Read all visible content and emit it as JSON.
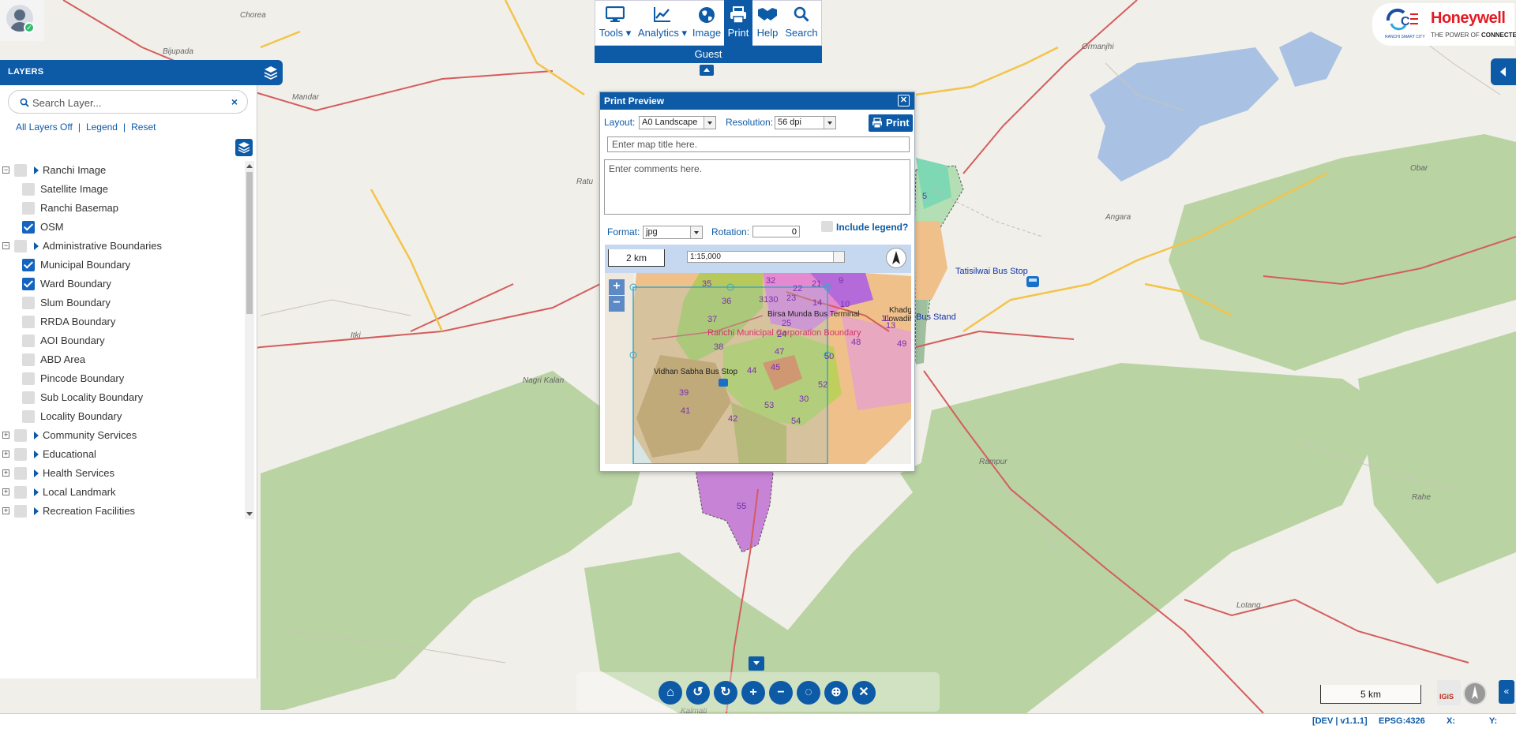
{
  "user": {
    "status": "online"
  },
  "layers_panel": {
    "title": "LAYERS",
    "search_placeholder": "Search Layer...",
    "clear_label": "×",
    "links": {
      "all_off": "All Layers Off",
      "legend": "Legend",
      "reset": "Reset"
    },
    "tree": [
      {
        "label": "Ranchi Image",
        "type": "group",
        "expand": "−",
        "checked": false
      },
      {
        "label": "Satellite Image",
        "type": "item",
        "checked": false
      },
      {
        "label": "Ranchi Basemap",
        "type": "item",
        "checked": false
      },
      {
        "label": "OSM",
        "type": "item",
        "checked": true
      },
      {
        "label": "Administrative Boundaries",
        "type": "group",
        "expand": "−",
        "checked": false
      },
      {
        "label": "Municipal Boundary",
        "type": "item",
        "checked": true
      },
      {
        "label": "Ward Boundary",
        "type": "item",
        "checked": true
      },
      {
        "label": "Slum Boundary",
        "type": "item",
        "checked": false
      },
      {
        "label": "RRDA Boundary",
        "type": "item",
        "checked": false
      },
      {
        "label": "AOI Boundary",
        "type": "item",
        "checked": false
      },
      {
        "label": "ABD Area",
        "type": "item",
        "checked": false
      },
      {
        "label": "Pincode Boundary",
        "type": "item",
        "checked": false
      },
      {
        "label": "Sub Locality Boundary",
        "type": "item",
        "checked": false
      },
      {
        "label": "Locality Boundary",
        "type": "item",
        "checked": false
      },
      {
        "label": "Community Services",
        "type": "group",
        "expand": "+",
        "checked": false
      },
      {
        "label": "Educational",
        "type": "group",
        "expand": "+",
        "checked": false
      },
      {
        "label": "Health Services",
        "type": "group",
        "expand": "+",
        "checked": false
      },
      {
        "label": "Local Landmark",
        "type": "group",
        "expand": "+",
        "checked": false
      },
      {
        "label": "Recreation Facilities",
        "type": "group",
        "expand": "+",
        "checked": false
      }
    ]
  },
  "toolbar": {
    "tools": [
      {
        "label": "Tools",
        "icon": "monitor-icon",
        "dropdown": true
      },
      {
        "label": "Analytics",
        "icon": "line-chart-icon",
        "dropdown": true
      },
      {
        "label": "Image",
        "icon": "globe-icon",
        "dropdown": false
      },
      {
        "label": "Print",
        "icon": "printer-icon",
        "dropdown": false,
        "active": true
      },
      {
        "label": "Help",
        "icon": "handshake-icon",
        "dropdown": false
      },
      {
        "label": "Search",
        "icon": "search-icon",
        "dropdown": false
      }
    ],
    "user_label": "Guest"
  },
  "branding": {
    "smart_city_text": "RANCHI SMART CITY",
    "honeywell": "Honeywell",
    "tagline_pre": "THE POWER OF ",
    "tagline_bold": "CONNECTED"
  },
  "map": {
    "places": [
      {
        "name": "Chorea"
      },
      {
        "name": "Bijupada"
      },
      {
        "name": "Mandar"
      },
      {
        "name": "Ratu"
      },
      {
        "name": "Itki"
      },
      {
        "name": "Nagri Kalan"
      },
      {
        "name": "Ormanjhi"
      },
      {
        "name": "Angara"
      },
      {
        "name": "Obar"
      },
      {
        "name": "Rampur"
      },
      {
        "name": "Rahe"
      },
      {
        "name": "Lotang"
      },
      {
        "name": "Kalmati"
      }
    ],
    "bus_stops": [
      "Tatisilwai Bus Stop",
      "Bus Stand"
    ],
    "ward_labels": [
      "5",
      "55"
    ]
  },
  "print_preview": {
    "title": "Print Preview",
    "layout_label": "Layout:",
    "layout_value": "A0 Landscape",
    "resolution_label": "Resolution:",
    "resolution_value": "56 dpi",
    "print_button": "Print",
    "title_placeholder": "Enter map title here.",
    "comments_placeholder": "Enter comments here.",
    "format_label": "Format:",
    "format_value": "jpg",
    "rotation_label": "Rotation:",
    "rotation_value": "0",
    "include_legend_label": "Include legend?",
    "include_legend": false,
    "preview_scale": "2 km",
    "preview_ratio": "1:15,000",
    "preview_labels": {
      "corp_boundary": "Ranchi Municipal Corporation Boundary",
      "bus_terminal": "Birsa Munda Bus Terminal",
      "vidhan_sabha": "Vidhan Sabha Bus Stop",
      "khadgarh": "Khadgarh",
      "lowadih": "Lowadih"
    },
    "preview_wards": [
      "35",
      "32",
      "22",
      "21",
      "9",
      "36",
      "3130",
      "23",
      "14",
      "10",
      "37",
      "25",
      "24",
      "38",
      "47",
      "48",
      "49",
      "45",
      "50",
      "44",
      "52",
      "39",
      "41",
      "42",
      "53",
      "54",
      "11",
      "13",
      "30"
    ]
  },
  "bottom_controls": [
    {
      "name": "home-button",
      "icon": "home-icon",
      "glyph": "⌂"
    },
    {
      "name": "undo-button",
      "icon": "undo-icon",
      "glyph": "↺"
    },
    {
      "name": "redo-button",
      "icon": "redo-icon",
      "glyph": "↻"
    },
    {
      "name": "zoom-in-button",
      "icon": "plus-icon",
      "glyph": "+"
    },
    {
      "name": "zoom-out-button",
      "icon": "minus-icon",
      "glyph": "−"
    },
    {
      "name": "hide-button",
      "icon": "eye-slash-icon",
      "glyph": "◌"
    },
    {
      "name": "locate-button",
      "icon": "crosshair-icon",
      "glyph": "⊕"
    },
    {
      "name": "clear-button",
      "icon": "clear-map-icon",
      "glyph": "✕"
    }
  ],
  "scale_bar": "5 km",
  "status_bar": {
    "version": "[DEV | v1.1.1]",
    "projection": "EPSG:4326",
    "x_label": "X:",
    "y_label": "Y:"
  },
  "colors": {
    "primary": "#0d5aa7",
    "ward_pink": "#e58ad1",
    "ward_purple": "#b46ad8",
    "road_red": "#d45d5d",
    "road_yellow": "#f3c44a",
    "water": "#a9c1e3",
    "forest": "#b9d3a3"
  }
}
